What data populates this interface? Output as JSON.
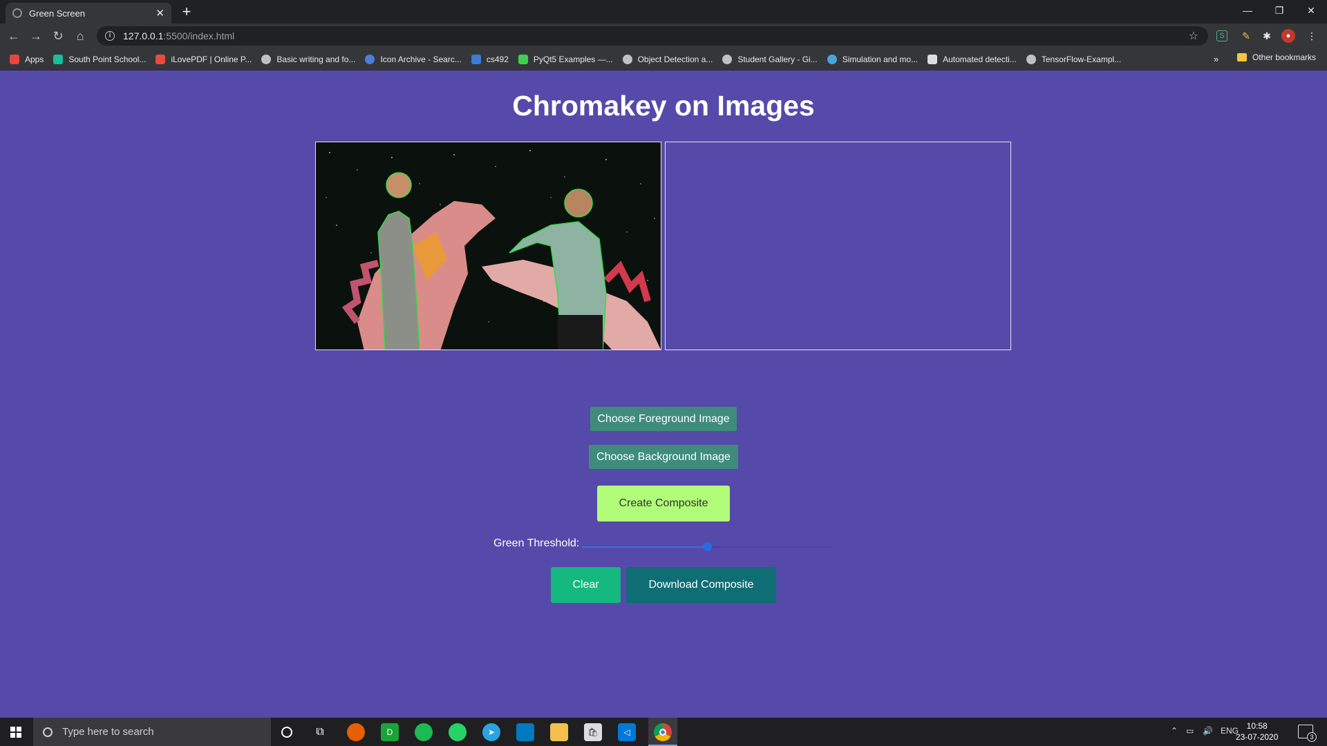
{
  "browser": {
    "tab_title": "Green Screen",
    "url_host": "127.0.0.1",
    "url_path": ":5500/index.html",
    "bookmarks": [
      {
        "label": "Apps",
        "color": "#e8453c"
      },
      {
        "label": "South Point School...",
        "color": "#1abc9c"
      },
      {
        "label": "iLovePDF | Online P...",
        "color": "#e74c3c"
      },
      {
        "label": "Basic writing and fo...",
        "color": "#bdc1c6"
      },
      {
        "label": "Icon Archive - Searc...",
        "color": "#4a7ed8"
      },
      {
        "label": "cs492",
        "color": "#3d7bd6"
      },
      {
        "label": "PyQt5 Examples —...",
        "color": "#41cd52"
      },
      {
        "label": "Object Detection a...",
        "color": "#bdc1c6"
      },
      {
        "label": "Student Gallery - Gi...",
        "color": "#bdc1c6"
      },
      {
        "label": "Simulation and mo...",
        "color": "#4aa3df"
      },
      {
        "label": "Automated detecti...",
        "color": "#dcdcdc"
      },
      {
        "label": "TensorFlow-Exampl...",
        "color": "#bdc1c6"
      }
    ],
    "more_bookmarks": "»",
    "other_bookmarks": "Other bookmarks"
  },
  "page": {
    "title": "Chromakey on Images",
    "foreground_button": "Choose Foreground Image",
    "background_button": "Choose Background Image",
    "create_button": "Create Composite",
    "threshold_label": "Green Threshold:",
    "threshold_value": 0.5,
    "clear_button": "Clear",
    "download_button": "Download Composite"
  },
  "taskbar": {
    "search_placeholder": "Type here to search",
    "language": "ENG",
    "time": "10:58",
    "date": "23-07-2020",
    "notification_count": "3"
  },
  "colors": {
    "page_background": "#554aaa",
    "file_button": "#3f8c7b",
    "create_button": "#b1fc79",
    "clear_button": "#15b87f",
    "download_button": "#0f6d74"
  }
}
